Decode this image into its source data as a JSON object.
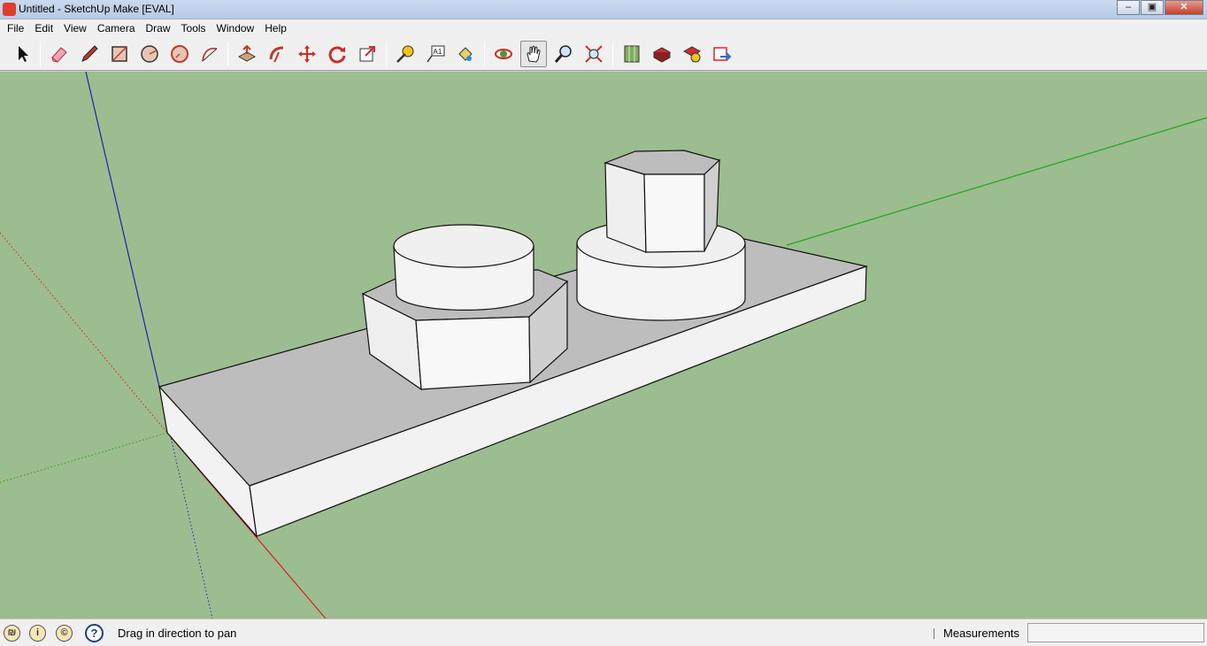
{
  "window": {
    "title": "Untitled - SketchUp Make [EVAL]"
  },
  "menu": [
    "File",
    "Edit",
    "View",
    "Camera",
    "Draw",
    "Tools",
    "Window",
    "Help"
  ],
  "toolbar": {
    "tools": [
      {
        "id": "select",
        "icon": "select-arrow-icon"
      },
      {
        "id": "eraser",
        "icon": "eraser-icon"
      },
      {
        "id": "line",
        "icon": "pencil-icon"
      },
      {
        "id": "rectangle",
        "icon": "rectangle-icon"
      },
      {
        "id": "circle",
        "icon": "circle-icon"
      },
      {
        "id": "polygon",
        "icon": "polygon-icon"
      },
      {
        "id": "arc",
        "icon": "arc-icon"
      },
      {
        "id": "push-pull",
        "icon": "push-pull-icon"
      },
      {
        "id": "follow-me",
        "icon": "follow-me-icon"
      },
      {
        "id": "move",
        "icon": "move-icon"
      },
      {
        "id": "rotate",
        "icon": "rotate-icon"
      },
      {
        "id": "scale",
        "icon": "scale-icon"
      },
      {
        "id": "tape-measure",
        "icon": "tape-measure-icon"
      },
      {
        "id": "text",
        "icon": "text-icon"
      },
      {
        "id": "paint-bucket",
        "icon": "paint-bucket-icon"
      },
      {
        "id": "orbit",
        "icon": "orbit-icon"
      },
      {
        "id": "pan",
        "icon": "hand-icon",
        "active": true
      },
      {
        "id": "zoom",
        "icon": "zoom-icon"
      },
      {
        "id": "zoom-extents",
        "icon": "zoom-extents-icon"
      },
      {
        "id": "add-location",
        "icon": "add-location-icon"
      },
      {
        "id": "share-model",
        "icon": "share-model-icon"
      },
      {
        "id": "get-models",
        "icon": "get-models-icon"
      },
      {
        "id": "share-component",
        "icon": "share-component-icon"
      }
    ],
    "text_tool_label": "A1"
  },
  "status": {
    "hint": "Drag in direction to pan",
    "help_symbol": "?",
    "measurements_label": "Measurements",
    "measurements_value": ""
  },
  "colors": {
    "sky_ground": "#9cbd8f",
    "axis_red": "#d42020",
    "axis_green": "#1fa51f",
    "axis_blue": "#1f1fb8",
    "face_top": "#bdbdbd",
    "face_front": "#f2f2f2"
  }
}
